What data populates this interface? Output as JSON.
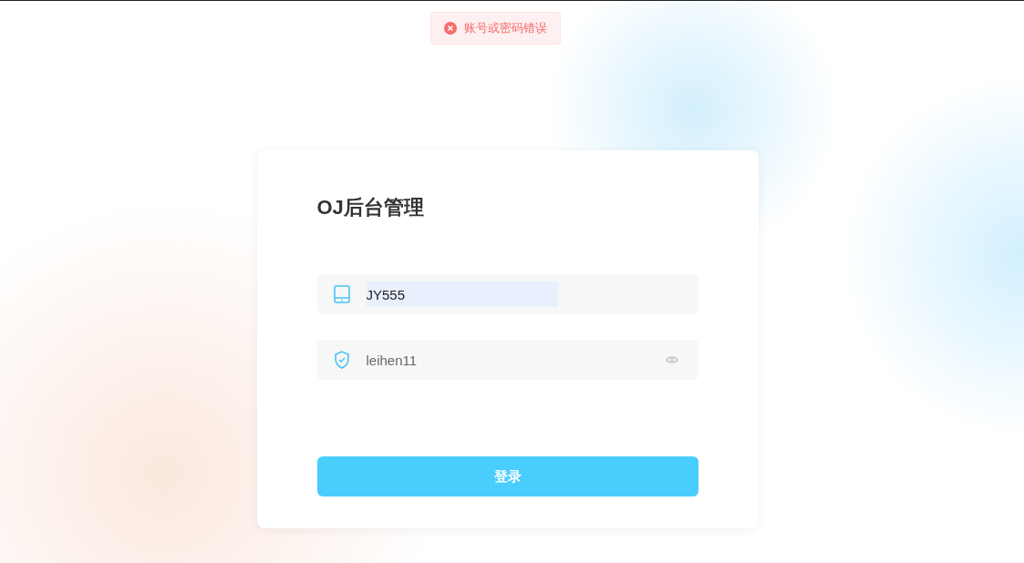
{
  "toast": {
    "kind": "error",
    "message": "账号或密码错误"
  },
  "login": {
    "title": "OJ后台管理",
    "fields": [
      {
        "kind": "account",
        "value": "JY555",
        "autofilled": true
      },
      {
        "kind": "password",
        "value": "leihen11",
        "autofilled": false
      }
    ],
    "submit": "登录"
  }
}
